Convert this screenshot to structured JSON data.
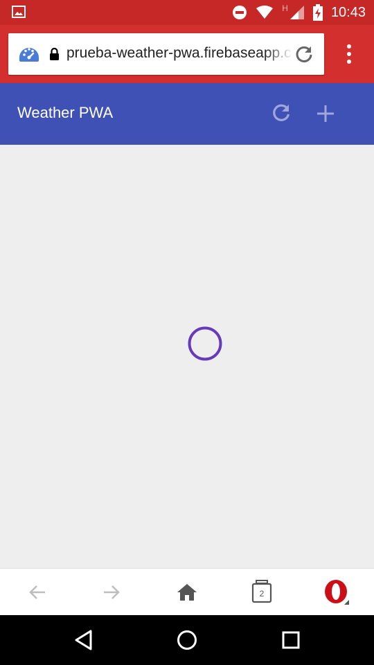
{
  "status_bar": {
    "time": "10:43",
    "network_letter": "H",
    "icons": [
      "gallery-icon",
      "do-not-disturb-icon",
      "wifi-icon",
      "cellular-signal-icon",
      "battery-charging-icon"
    ]
  },
  "browser": {
    "url": "prueba-weather-pwa.firebaseapp.com",
    "icons": [
      "speed-dial-icon",
      "lock-icon",
      "reload-icon",
      "overflow-menu-icon"
    ]
  },
  "app": {
    "title": "Weather PWA",
    "header_color": "#3f51b5",
    "icons": [
      "refresh-icon",
      "add-icon"
    ]
  },
  "loader": {
    "color": "#673ab7",
    "icon": "loading-spinner"
  },
  "opera_bar": {
    "tab_count": "2",
    "icons": [
      "back-arrow-icon",
      "forward-arrow-icon",
      "home-icon",
      "tabs-icon",
      "opera-logo-icon"
    ]
  },
  "system_nav": {
    "icons": [
      "back-triangle-icon",
      "home-circle-icon",
      "recents-square-icon"
    ]
  }
}
